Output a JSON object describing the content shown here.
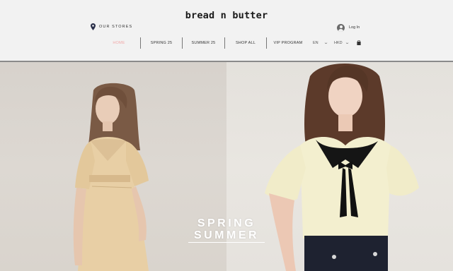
{
  "brand": {
    "logo_text": "bread n butter"
  },
  "header": {
    "stores_label": "OUR STORES",
    "login_label": "Log In"
  },
  "nav": {
    "items": [
      {
        "label": "HOME",
        "active": true
      },
      {
        "label": "SPRING 25",
        "active": false
      },
      {
        "label": "SUMMER 25",
        "active": false
      },
      {
        "label": "SHOP ALL",
        "active": false
      },
      {
        "label": "VIP PROGRAM",
        "active": false
      }
    ],
    "language": "EN",
    "currency": "HKD"
  },
  "hero": {
    "line1": "SPRING",
    "line2": "SUMMER"
  },
  "colors": {
    "active_nav": "#f1a9a9",
    "header_bg": "#f2f2f2",
    "text": "#333333"
  },
  "icons": [
    "location-pin-icon",
    "user-avatar-icon",
    "chevron-down-icon",
    "shopping-bag-icon"
  ]
}
